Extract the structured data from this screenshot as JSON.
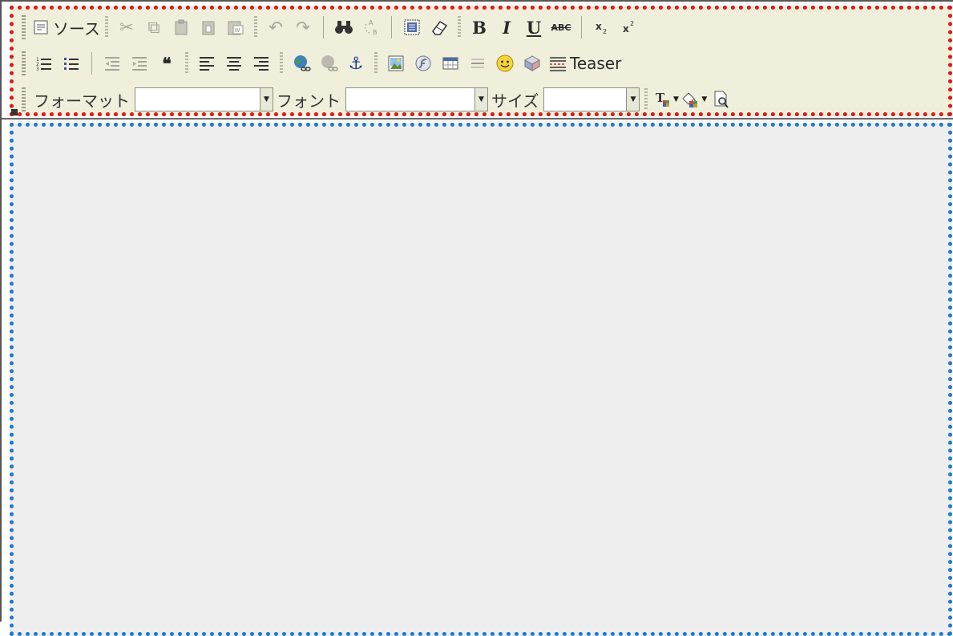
{
  "toolbar": {
    "row1": {
      "source_label": "ソース"
    },
    "row2": {
      "teaser_label": "Teaser"
    },
    "row3": {
      "format_label": "フォーマット",
      "format_value": "",
      "font_label": "フォント",
      "font_value": "",
      "size_label": "サイズ",
      "size_value": ""
    }
  },
  "icons": [
    "source-icon",
    "cut-icon",
    "copy-icon",
    "paste-icon",
    "paste-text-icon",
    "paste-word-icon",
    "undo-icon",
    "redo-icon",
    "find-icon",
    "replace-icon",
    "select-all-icon",
    "remove-format-icon",
    "bold-icon",
    "italic-icon",
    "underline-icon",
    "strikethrough-icon",
    "subscript-icon",
    "superscript-icon",
    "numbered-list-icon",
    "bulleted-list-icon",
    "outdent-icon",
    "indent-icon",
    "blockquote-icon",
    "align-left-icon",
    "align-center-icon",
    "align-right-icon",
    "link-icon",
    "unlink-icon",
    "anchor-icon",
    "image-icon",
    "flash-icon",
    "table-icon",
    "horizontal-rule-icon",
    "smiley-icon",
    "special-char-icon",
    "teaser-icon",
    "text-color-icon",
    "background-color-icon",
    "preview-icon"
  ],
  "colors": {
    "toolbar_bg": "#efefdc",
    "toolbar_highlight": "#e01414",
    "editor_highlight": "#1c79d4",
    "editor_bg": "#eeeeee"
  }
}
